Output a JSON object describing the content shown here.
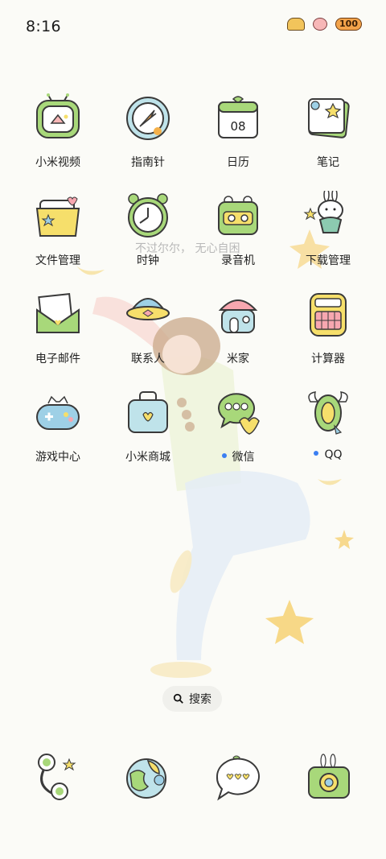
{
  "status_bar": {
    "time": "8:16",
    "battery": "100"
  },
  "apps": [
    {
      "label": "小米视频",
      "icon": "video-icon",
      "dot": false
    },
    {
      "label": "指南针",
      "icon": "compass-icon",
      "dot": false
    },
    {
      "label": "日历",
      "icon": "calendar-icon",
      "dot": false,
      "day": "08"
    },
    {
      "label": "笔记",
      "icon": "notes-icon",
      "dot": false
    },
    {
      "label": "文件管理",
      "icon": "folder-icon",
      "dot": false
    },
    {
      "label": "时钟",
      "icon": "clock-icon",
      "dot": false
    },
    {
      "label": "录音机",
      "icon": "recorder-icon",
      "dot": false
    },
    {
      "label": "下载管理",
      "icon": "download-icon",
      "dot": false
    },
    {
      "label": "电子邮件",
      "icon": "mail-icon",
      "dot": false
    },
    {
      "label": "联系人",
      "icon": "contacts-icon",
      "dot": false
    },
    {
      "label": "米家",
      "icon": "home-icon",
      "dot": false
    },
    {
      "label": "计算器",
      "icon": "calculator-icon",
      "dot": false
    },
    {
      "label": "游戏中心",
      "icon": "gamepad-icon",
      "dot": false
    },
    {
      "label": "小米商城",
      "icon": "shop-bag-icon",
      "dot": false
    },
    {
      "label": "微信",
      "icon": "wechat-icon",
      "dot": true
    },
    {
      "label": "QQ",
      "icon": "qq-icon",
      "dot": true
    }
  ],
  "wallpaper_text": "不过尔尔， 无心自困",
  "search": {
    "label": "搜索"
  },
  "dock": [
    "phone-icon",
    "browser-globe-icon",
    "messages-icon",
    "camera-icon"
  ],
  "colors": {
    "accent_green": "#a8d87a",
    "accent_yellow": "#f6df6b",
    "dot_blue": "#3b7ff2"
  }
}
